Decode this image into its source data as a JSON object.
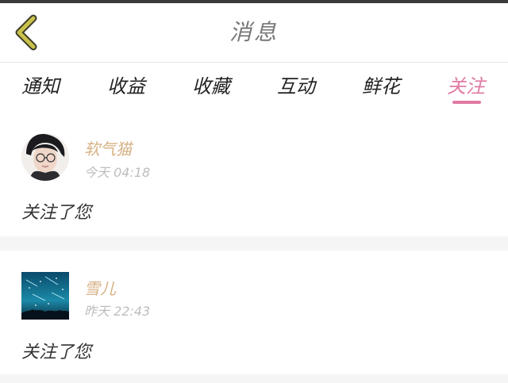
{
  "header": {
    "title": "消息",
    "back_icon": "chevron-left-icon",
    "back_color": "#c9c24a"
  },
  "tabs": [
    {
      "label": "通知",
      "active": false
    },
    {
      "label": "收益",
      "active": false
    },
    {
      "label": "收藏",
      "active": false
    },
    {
      "label": "互动",
      "active": false
    },
    {
      "label": "鲜花",
      "active": false
    },
    {
      "label": "关注",
      "active": true
    }
  ],
  "colors": {
    "accent": "#e07aa4",
    "username": "#d6b184",
    "timestamp": "#bdbdbd"
  },
  "messages": [
    {
      "username": "软气猫",
      "time": "今天 04:18",
      "text": "关注了您",
      "avatar": "portrait-avatar"
    },
    {
      "username": "雪儿",
      "time": "昨天 22:43",
      "text": "关注了您",
      "avatar": "starry-sky-avatar"
    }
  ]
}
